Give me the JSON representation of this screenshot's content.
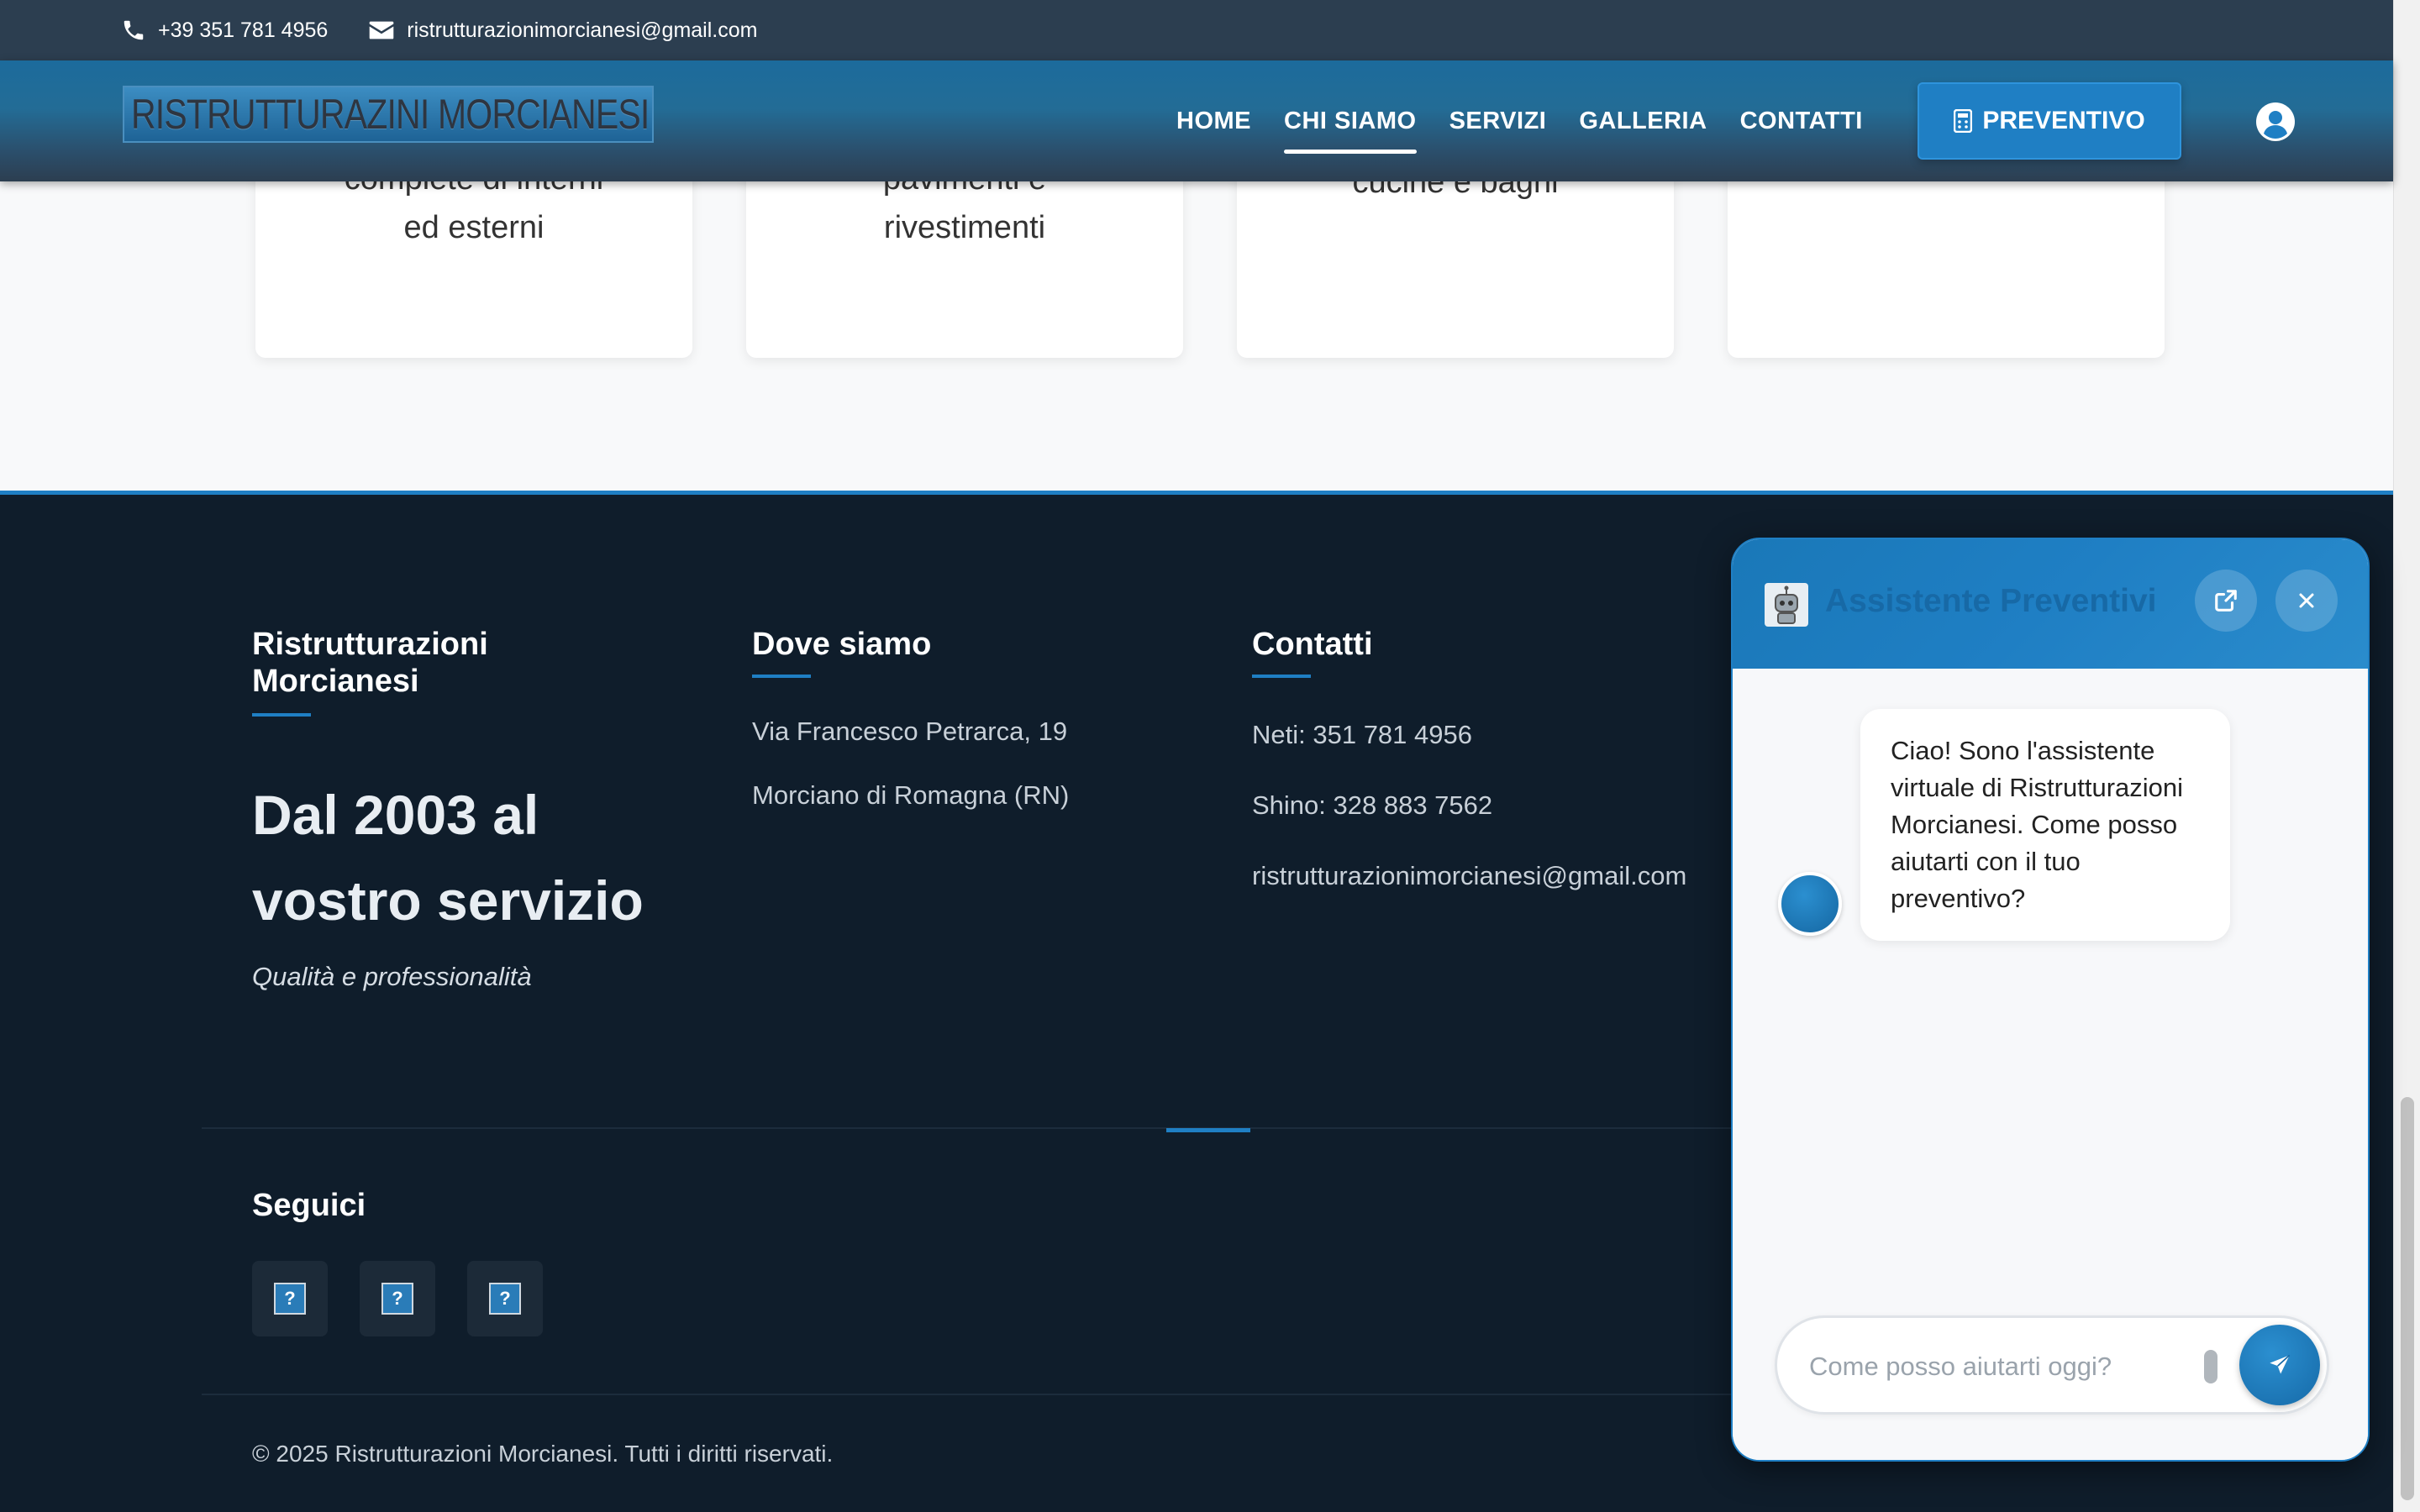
{
  "topbar": {
    "phone": "+39 351 781 4956",
    "email": "ristrutturazionimorcianesi@gmail.com"
  },
  "header": {
    "logo_text": "RISTRUTTURAZINI MORCIANESI",
    "nav": [
      "HOME",
      "CHI SIAMO",
      "SERVIZI",
      "GALLERIA",
      "CONTATTI"
    ],
    "active_nav": "CHI SIAMO",
    "cta_label": "PREVENTIVO"
  },
  "cards": [
    {
      "line1": "complete di interni",
      "line2": "ed esterni"
    },
    {
      "line1": "pavimenti e",
      "line2": "rivestimenti"
    },
    {
      "line1": "cucine e bagni",
      "line2": ""
    },
    {
      "line1": "",
      "line2": ""
    }
  ],
  "footer": {
    "col1_title": "Ristrutturazioni Morcianesi",
    "claim": "Dal 2003 al vostro servizio",
    "tagline": "Qualità e professionalità",
    "col2_title": "Dove siamo",
    "address1": "Via Francesco Petrarca, 19",
    "address2": "Morciano di Romagna (RN)",
    "col3_title": "Contatti",
    "contact1": "Neti: 351 781 4956",
    "contact2": "Shino: 328 883 7562",
    "contact3": "ristrutturazionimorcianesi@gmail.com",
    "follow_title": "Seguici",
    "social_icons": [
      "broken-image-icon",
      "broken-image-icon",
      "broken-image-icon"
    ],
    "copyright": "© 2025 Ristrutturazioni Morcianesi. Tutti i diritti riservati."
  },
  "chat": {
    "title": "Assistente Preventivi",
    "bot_message": "Ciao! Sono l'assistente virtuale di Ristrutturazioni Morcianesi. Come posso aiutarti con il tuo preventivo?",
    "input_placeholder": "Come posso aiutarti oggi?",
    "input_value": ""
  },
  "colors": {
    "accent": "#1f7fc4",
    "footer_bg": "#0f1d2b",
    "topbar_bg": "#2c3e50",
    "section_bg": "#f8f9fa"
  }
}
